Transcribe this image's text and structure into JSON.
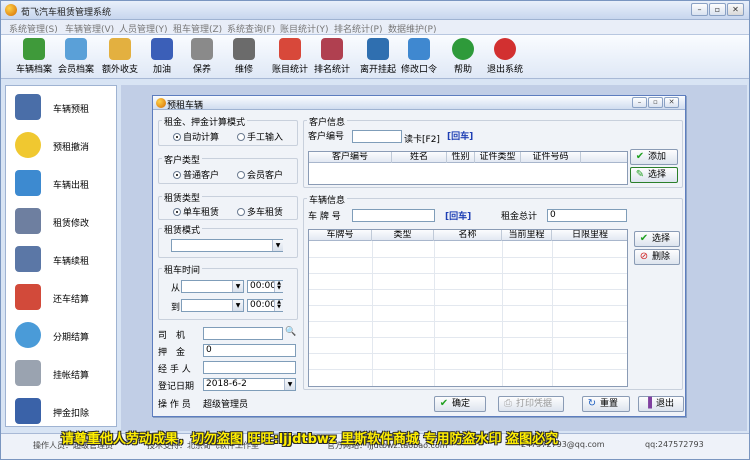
{
  "app": {
    "title": "荀飞汽车租赁管理系统",
    "menu": [
      "系统管理(S)",
      "车辆管理(V)",
      "人员管理(Y)",
      "租车管理(Z)",
      "系统查询(F)",
      "账目统计(Y)",
      "排名统计(P)",
      "数据维护(P)"
    ],
    "toolbar": [
      "车辆档案",
      "会员档案",
      "额外收支",
      "加油",
      "保养",
      "维修",
      "账目统计",
      "排名统计",
      "离开挂起",
      "修改口令",
      "帮助",
      "退出系统"
    ],
    "sidebar": [
      "车辆预租",
      "预租撤消",
      "车辆出租",
      "租赁修改",
      "车辆续租",
      "还车结算",
      "分期结算",
      "挂帐结算",
      "押金扣除"
    ]
  },
  "dialog": {
    "title": "预租车辆",
    "deposit_mode": {
      "label": "租金、押金计算模式",
      "options": [
        "自动计算",
        "手工输入"
      ],
      "selected": 0
    },
    "customer_type": {
      "label": "客户类型",
      "options": [
        "普通客户",
        "会员客户"
      ],
      "selected": 0
    },
    "rent_type": {
      "label": "租赁类型",
      "options": [
        "单车租赁",
        "多车租赁"
      ],
      "selected": 0
    },
    "rent_mode": {
      "label": "租赁模式",
      "value": ""
    },
    "rent_time": {
      "label": "租车时间",
      "from": "从",
      "to": "到",
      "from_time": "00:00",
      "to_time": "00:00"
    },
    "fields": {
      "driver_label": "司　机",
      "deposit_label": "押　金",
      "deposit_value": "0",
      "handler_label": "经 手 人",
      "date_label": "登记日期",
      "date_value": "2018-6-2",
      "operator_label": "操 作 员",
      "operator_value": "超级管理员"
    },
    "customer": {
      "group": "客户信息",
      "id_label": "客户编号",
      "read_card": "读卡[F2]",
      "enter": "[回车]",
      "columns": [
        "客户编号",
        "姓名",
        "性别",
        "证件类型",
        "证件号码"
      ],
      "add": "添加",
      "select": "选择"
    },
    "vehicle": {
      "group": "车辆信息",
      "plate_label": "车 牌 号",
      "enter": "[回车]",
      "total_label": "租金总计",
      "total_value": "0",
      "columns": [
        "车牌号",
        "类型",
        "名称",
        "当前里程",
        "日限里程"
      ],
      "select": "选择",
      "delete": "删除"
    },
    "buttons": {
      "ok": "确定",
      "print": "打印凭据",
      "reset": "重置",
      "exit": "退出"
    }
  },
  "status": {
    "operator": "操作人员：超级管理员",
    "tech": "技术支持：北京荀飞软件工作室",
    "site": "官方网站：ljjdtbwz.taobao.com",
    "qq": "247572793@qq.com",
    "qq2": "qq:247572793"
  },
  "watermark": "请尊重他人劳动成果，切勿盗图 旺旺:ljjdtbwz 里斯软件商城 专用防盗水印 盗图必究"
}
